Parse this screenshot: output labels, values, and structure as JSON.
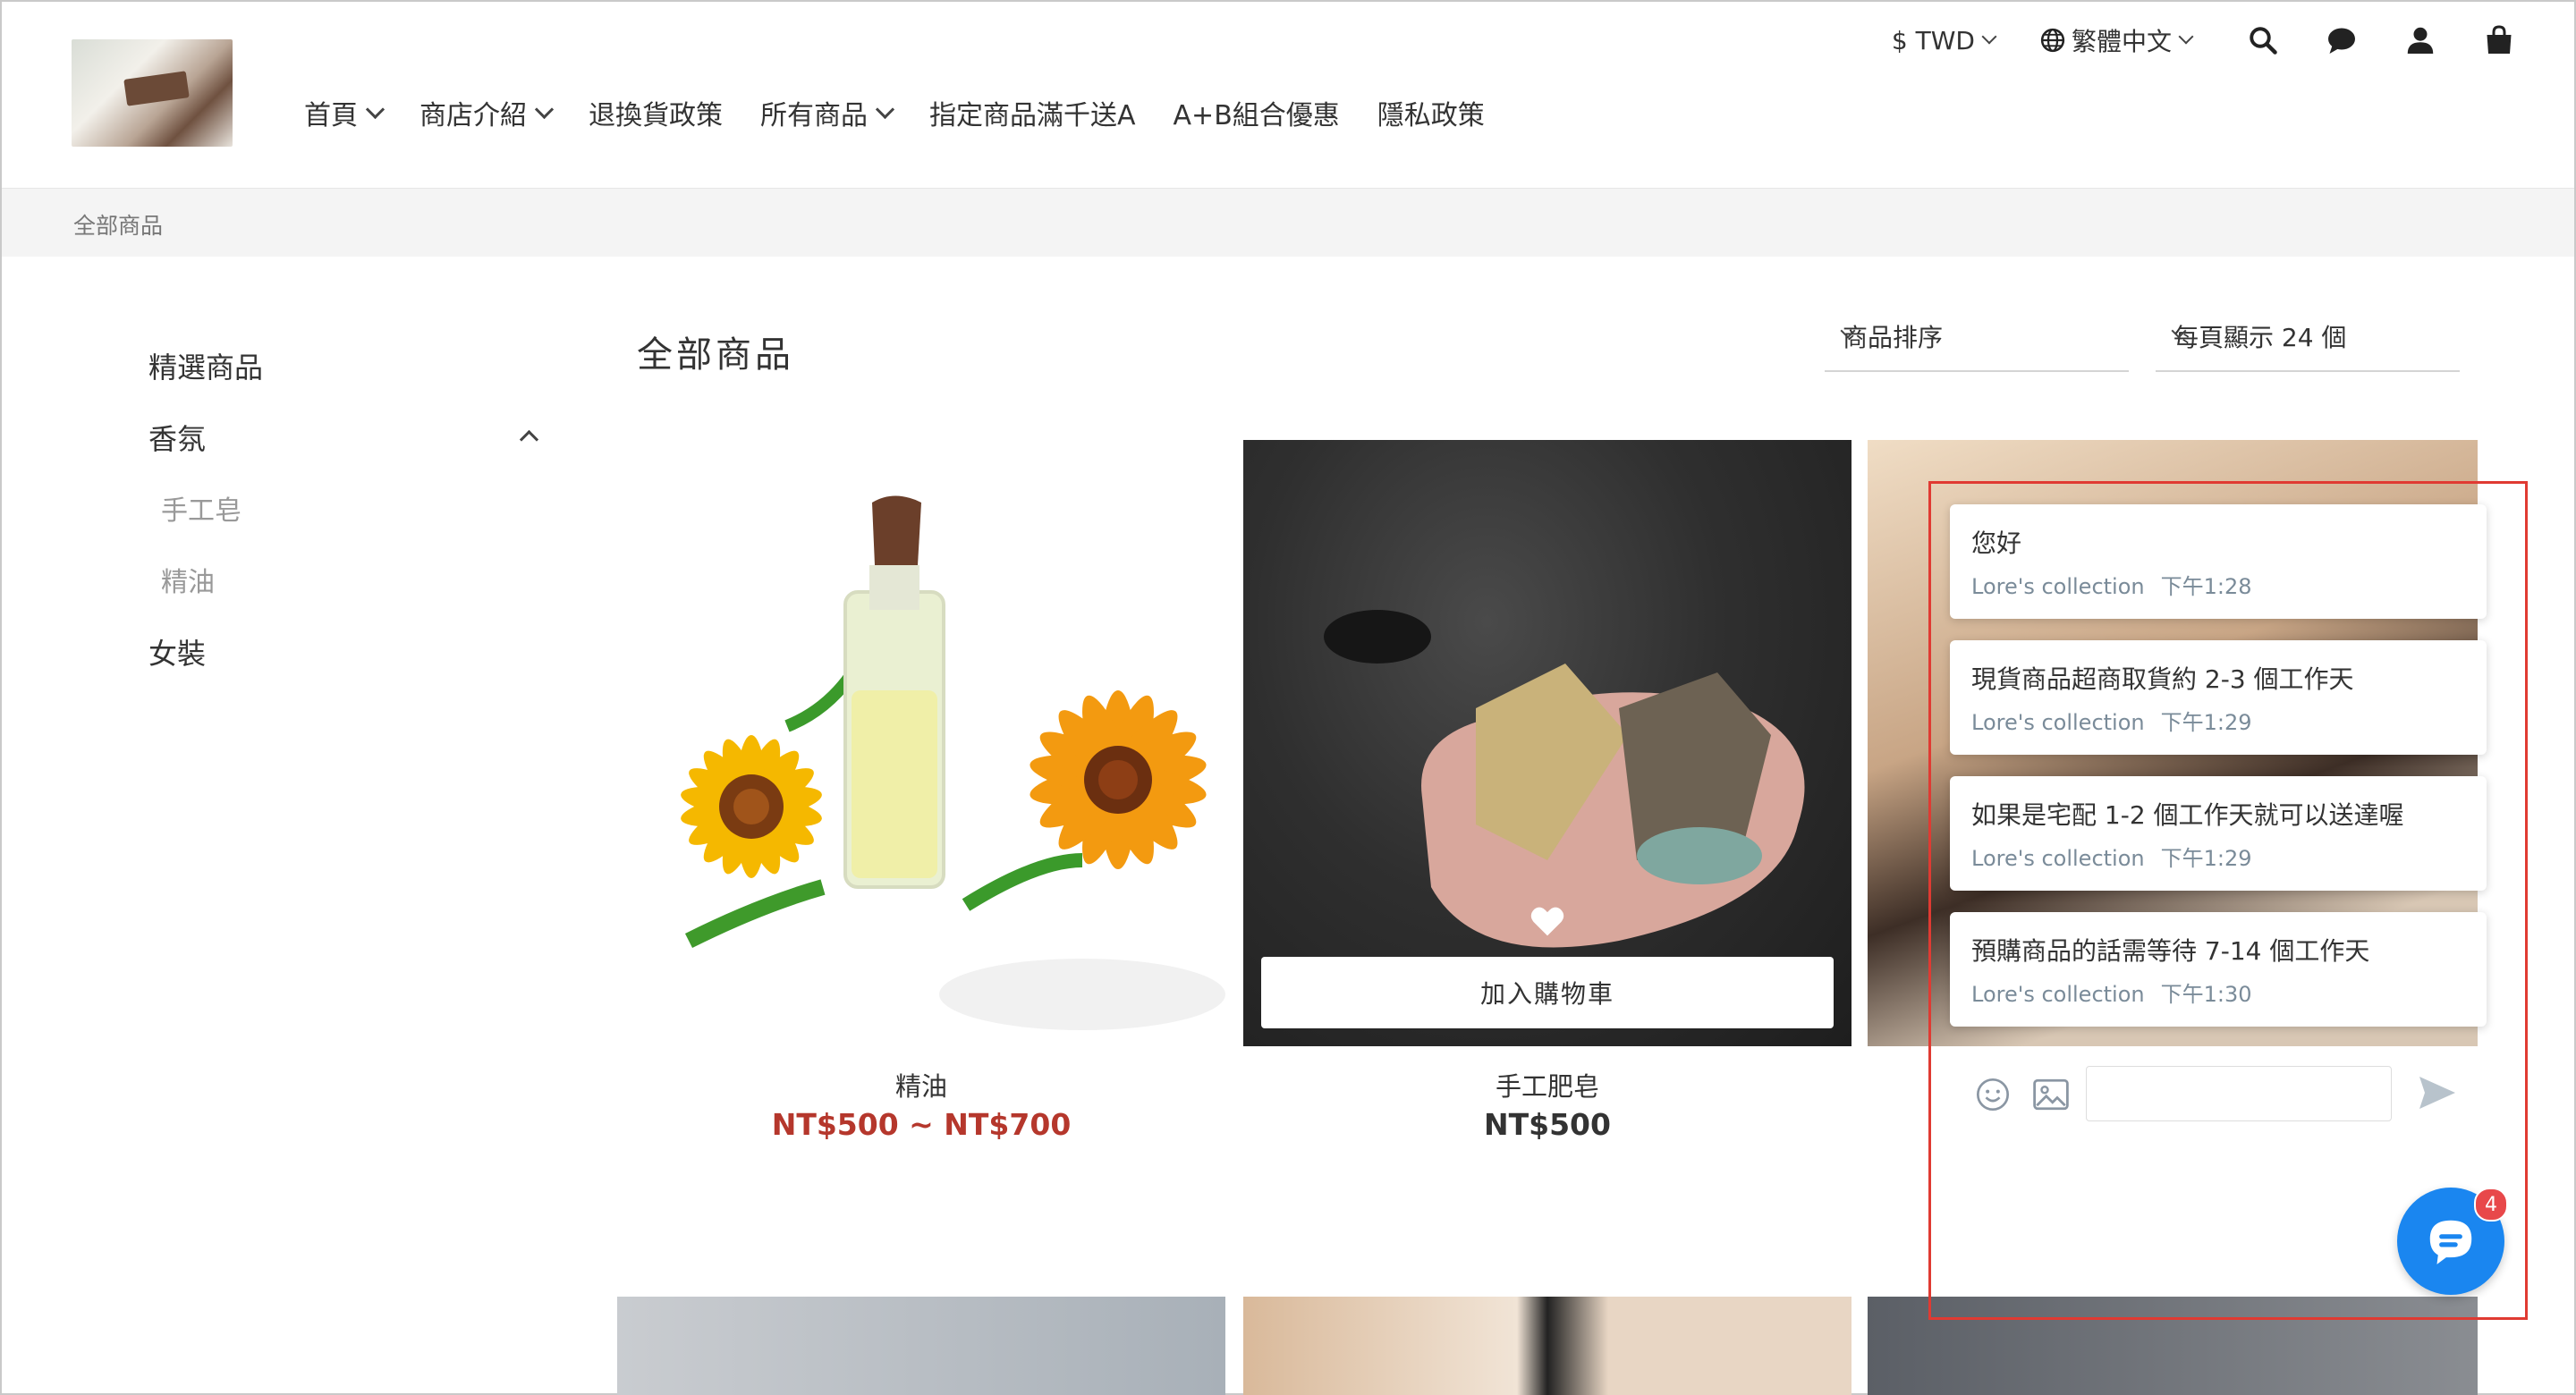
{
  "header": {
    "nav": [
      {
        "label": "首頁",
        "dropdown": true
      },
      {
        "label": "商店介紹",
        "dropdown": true
      },
      {
        "label": "退換貨政策",
        "dropdown": false
      },
      {
        "label": "所有商品",
        "dropdown": true
      },
      {
        "label": "指定商品滿千送A",
        "dropdown": false
      },
      {
        "label": "A+B組合優惠",
        "dropdown": false
      },
      {
        "label": "隱私政策",
        "dropdown": false
      }
    ],
    "currency": "$ TWD",
    "language": "繁體中文",
    "icons": [
      "search-icon",
      "chat-icon",
      "user-icon",
      "shopping-bag-icon"
    ]
  },
  "breadcrumb": "全部商品",
  "sidebar": {
    "items": [
      {
        "label": "精選商品"
      },
      {
        "label": "香氛"
      },
      {
        "label": "手工皂"
      },
      {
        "label": "精油"
      },
      {
        "label": "女裝"
      }
    ]
  },
  "main": {
    "title": "全部商品",
    "sort_label": "商品排序",
    "per_page_label": "每頁顯示 24 個"
  },
  "products": [
    {
      "name": "精油",
      "price": "NT$500 ~ NT$700",
      "price_color": "#b5372c"
    },
    {
      "name": "手工肥皂",
      "price": "NT$500",
      "price_color": "#333333",
      "cart_label": "加入購物車"
    }
  ],
  "chat": {
    "messages": [
      {
        "text": "您好",
        "sender": "Lore's collection",
        "time": "下午1:28"
      },
      {
        "text": "現貨商品超商取貨約 2-3 個工作天",
        "sender": "Lore's collection",
        "time": "下午1:29"
      },
      {
        "text": "如果是宅配 1-2 個工作天就可以送達喔",
        "sender": "Lore's collection",
        "time": "下午1:29"
      },
      {
        "text": "預購商品的話需等待 7-14 個工作天",
        "sender": "Lore's collection",
        "time": "下午1:30"
      }
    ],
    "unread_count": "4",
    "launcher_color": "#1a86f0",
    "highlight_color": "#e03a32"
  }
}
